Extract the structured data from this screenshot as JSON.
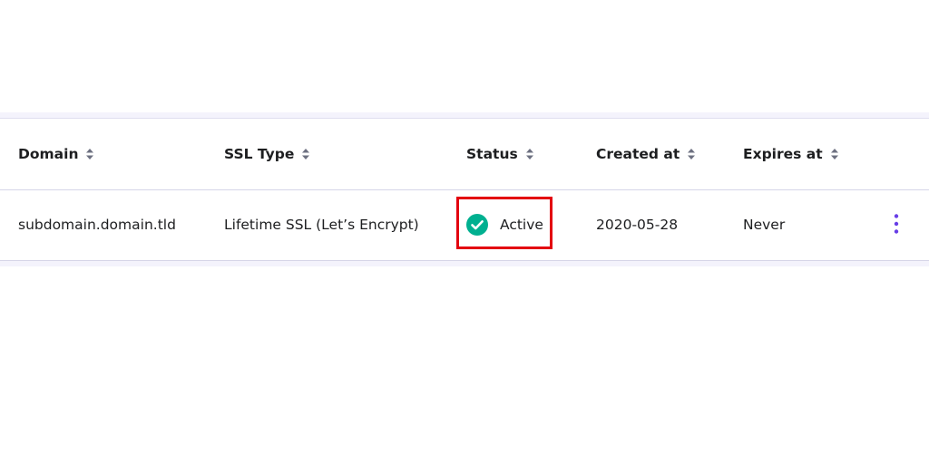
{
  "table": {
    "headers": [
      {
        "label": "Domain"
      },
      {
        "label": "SSL Type"
      },
      {
        "label": "Status"
      },
      {
        "label": "Created at"
      },
      {
        "label": "Expires at"
      }
    ],
    "rows": [
      {
        "domain": "subdomain.domain.tld",
        "ssl_type": "Lifetime SSL (Let’s Encrypt)",
        "status": "Active",
        "created_at": "2020-05-28",
        "expires_at": "Never"
      }
    ]
  },
  "icons": {
    "sort": "sort-icon",
    "status": "check-circle-icon",
    "more": "more-vertical-icon"
  },
  "colors": {
    "header_text": "#1d1e20",
    "status_ok": "#00b090",
    "highlight_border": "#e3000f",
    "more_icon": "#673de6"
  }
}
